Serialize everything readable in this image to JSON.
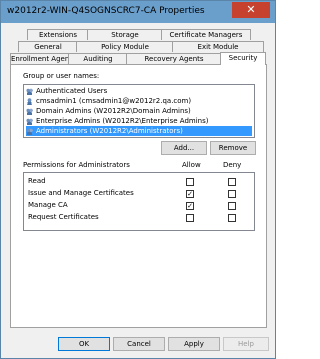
{
  "window": {
    "title": "w2012r2-WIN-Q4SOGNSCRC7-CA Properties",
    "close_glyph": "✕"
  },
  "tabs": {
    "row1": [
      "Extensions",
      "Storage",
      "Certificate Managers"
    ],
    "row2": [
      "General",
      "Policy Module",
      "Exit Module"
    ],
    "row3": [
      "Enrollment Agents",
      "Auditing",
      "Recovery Agents",
      "Security"
    ],
    "active": "Security"
  },
  "security": {
    "group_label": "Group or user names:",
    "principals": [
      {
        "name": "Authenticated Users",
        "icon": "group-icon",
        "selected": false
      },
      {
        "name": "cmsadmin1 (cmsadmin1@w2012r2.qa.com)",
        "icon": "user-icon",
        "selected": false
      },
      {
        "name": "Domain Admins (W2012R2\\Domain Admins)",
        "icon": "group-icon",
        "selected": false
      },
      {
        "name": "Enterprise Admins (W2012R2\\Enterprise Admins)",
        "icon": "group-icon",
        "selected": false
      },
      {
        "name": "Administrators (W2012R2\\Administrators)",
        "icon": "group-icon",
        "selected": true
      }
    ],
    "add_label": "Add...",
    "remove_label": "Remove",
    "permissions_label": "Permissions for Administrators",
    "allow_header": "Allow",
    "deny_header": "Deny",
    "permissions": [
      {
        "name": "Read",
        "allow": false,
        "deny": false
      },
      {
        "name": "Issue and Manage Certificates",
        "allow": true,
        "deny": false
      },
      {
        "name": "Manage CA",
        "allow": true,
        "deny": false
      },
      {
        "name": "Request Certificates",
        "allow": false,
        "deny": false
      }
    ]
  },
  "footer": {
    "ok": "OK",
    "cancel": "Cancel",
    "apply": "Apply",
    "help": "Help"
  },
  "colors": {
    "selection": "#3399ff",
    "titlebar": "#6a9ecb",
    "close": "#c7422e"
  }
}
